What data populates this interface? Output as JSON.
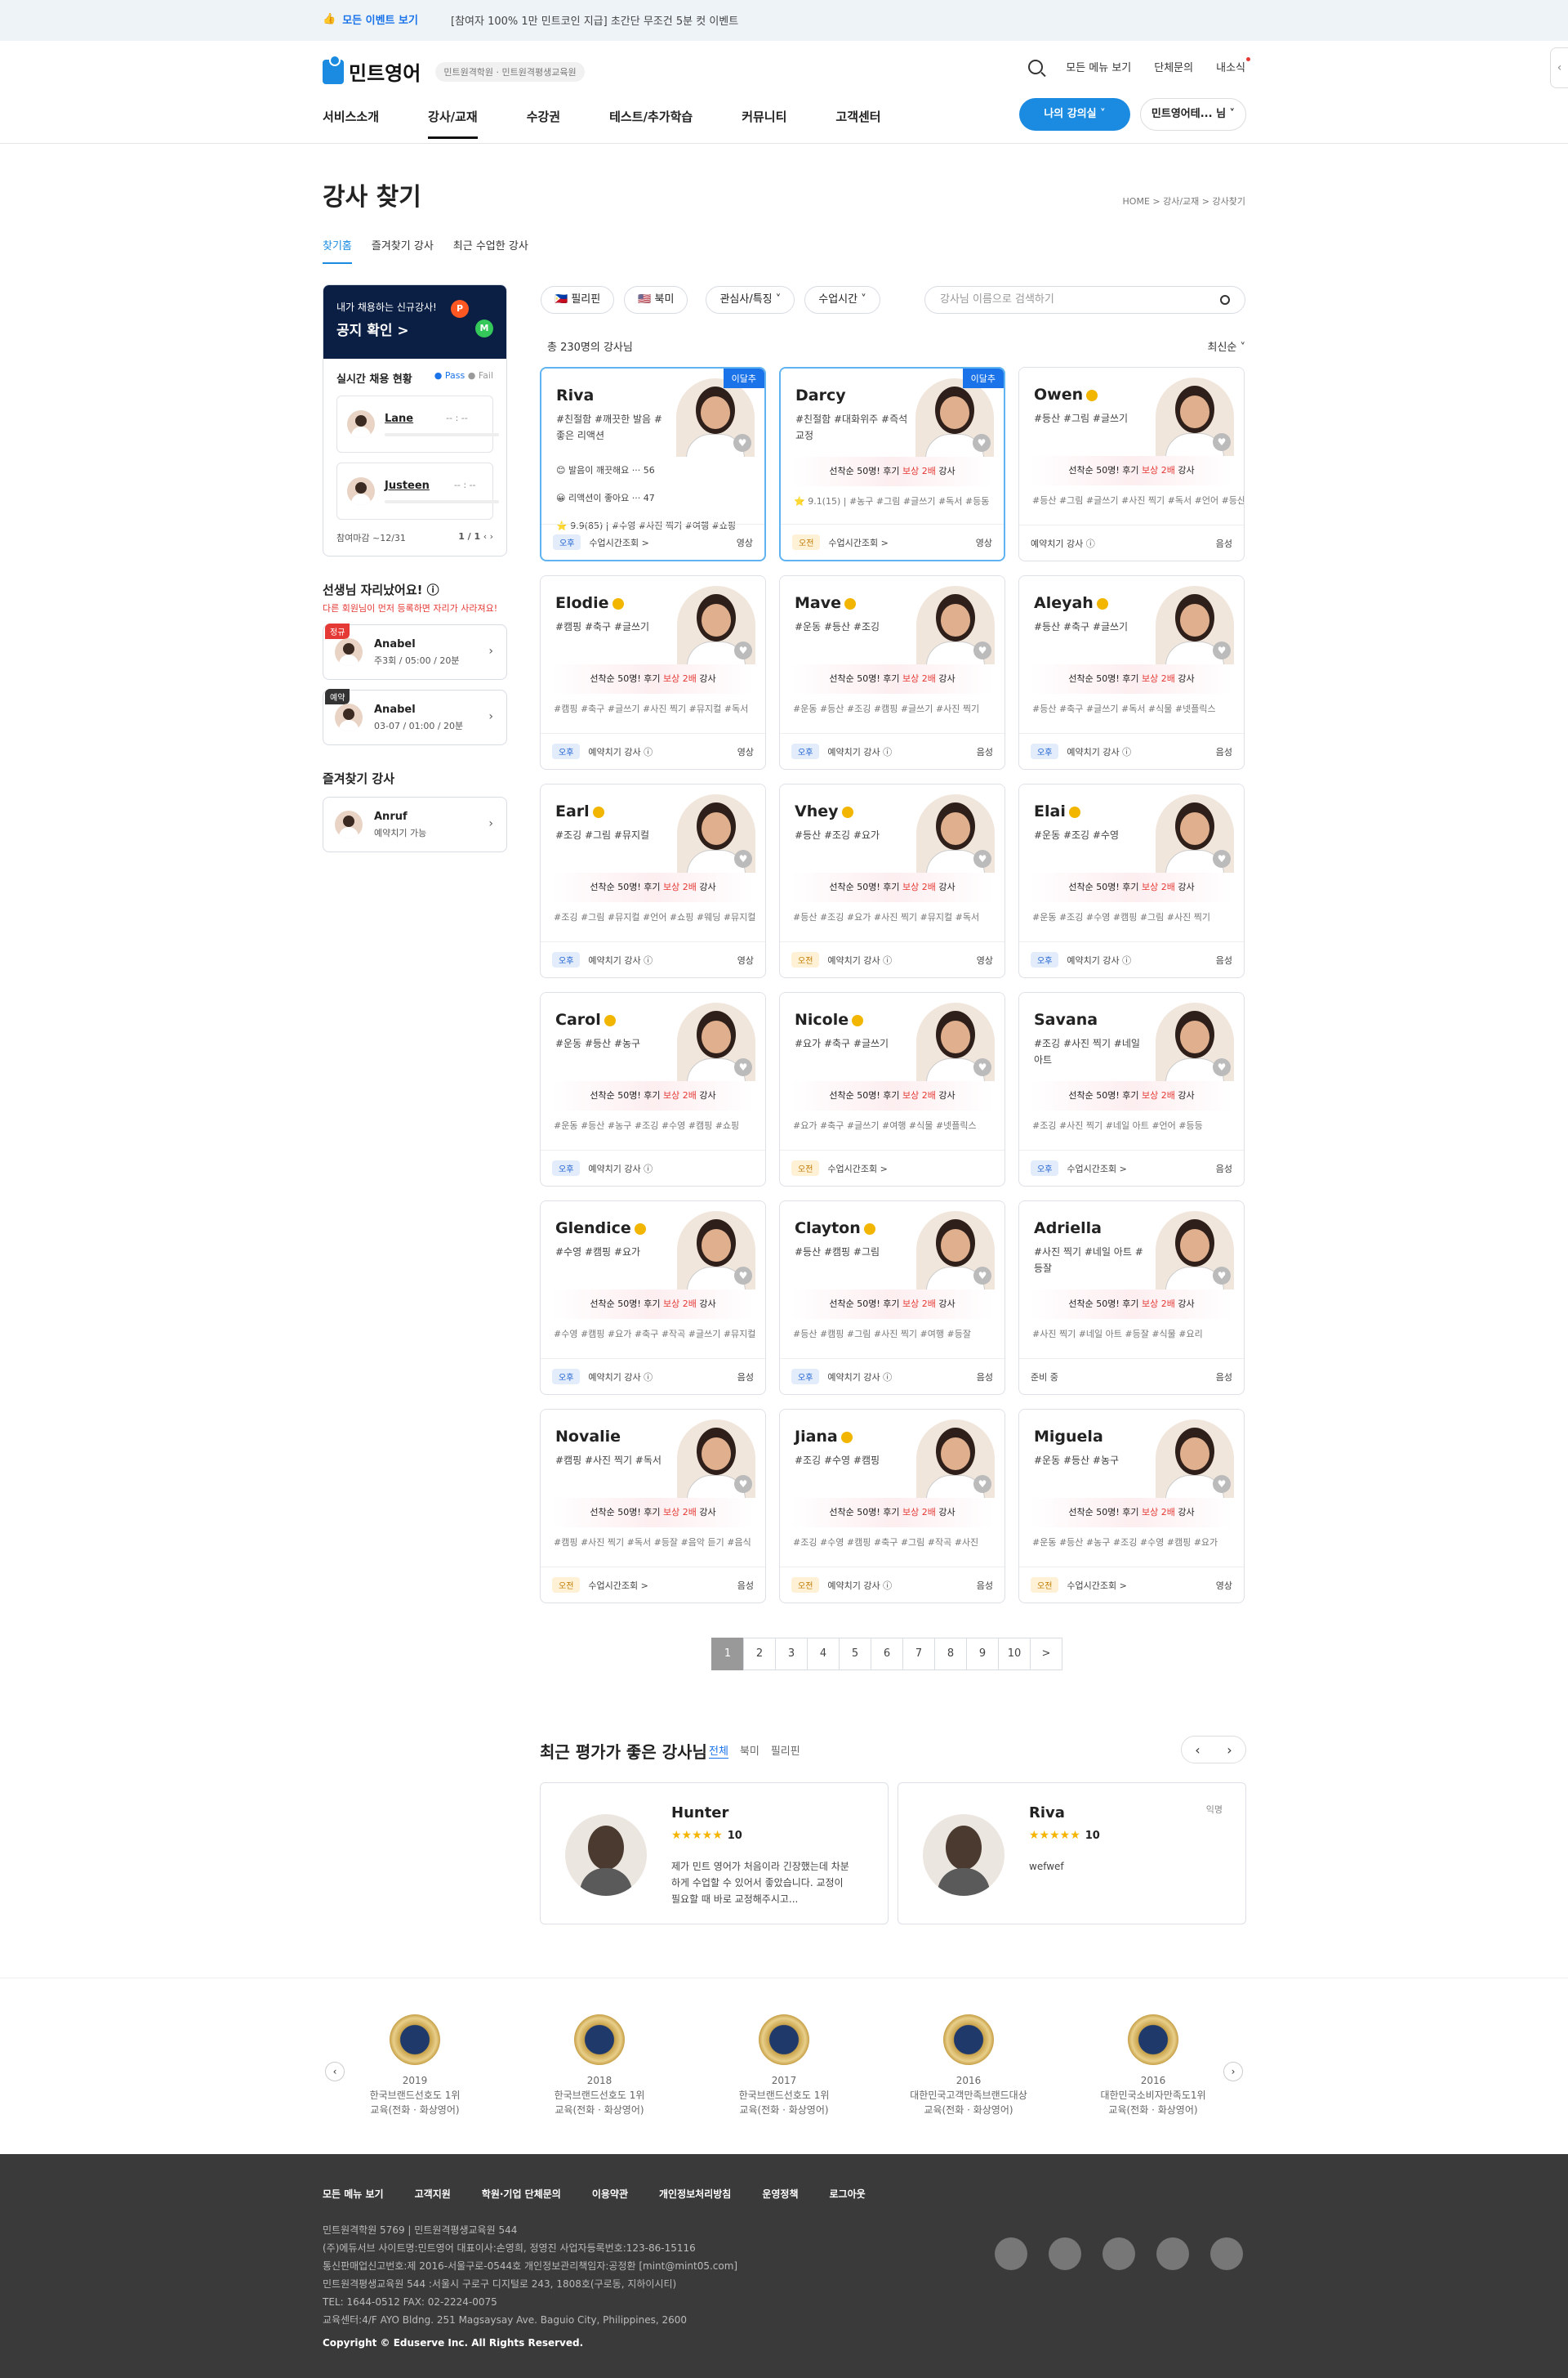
{
  "topbar": {
    "event_label": "모든 이벤트 보기",
    "notice": "[참여자 100% 1만 민트코인 지급] 초간단 무조건 5분 컷 이벤트"
  },
  "header": {
    "brand": "민트영어",
    "brand_sub": "민트원격학원 · 민트원격평생교육원",
    "links": [
      "모든 메뉴 보기",
      "단체문의",
      "내소식"
    ],
    "nav": [
      "서비스소개",
      "강사/교재",
      "수강권",
      "테스트/추가학습",
      "커뮤니티",
      "고객센터"
    ],
    "my_class": "나의 강의실 ˅",
    "user": "민트영어테... 님 ˅"
  },
  "page": {
    "title": "강사 찾기",
    "breadcrumb": "HOME > 강사/교재 > 강사찾기",
    "tabs": [
      "찾기홈",
      "즐겨찾기 강사",
      "최근 수업한 강사"
    ]
  },
  "sidebar": {
    "notice_small": "내가 채용하는 신규강사!",
    "notice_big": "공지 확인 >",
    "hiring_title": "실시간 채용 현황",
    "pass": "● Pass",
    "fail": "● Fail",
    "hires": [
      {
        "name": "Lane",
        "val": "-- : --"
      },
      {
        "name": "Justeen",
        "val": "-- : --"
      }
    ],
    "deadline": "참여마감 ~12/31",
    "page": "1 / 1",
    "slot_title": "선생님 자리났어요! ⓘ",
    "slot_sub": "다른 회원님이 먼저 등록하면 자리가 사라져요!",
    "slots": [
      {
        "tag": "정규",
        "name": "Anabel",
        "info": "주3회 / 05:00 / 20분"
      },
      {
        "tag": "예약",
        "name": "Anabel",
        "info": "03-07 / 01:00 / 20분"
      }
    ],
    "fav_title": "즐겨찾기 강사",
    "fav": {
      "name": "Anruf",
      "info": "예약치기 가능"
    }
  },
  "filters": {
    "chips": [
      "🇵🇭 필리핀",
      "🇺🇸 북미",
      "관심사/특징 ˅",
      "수업시간 ˅"
    ],
    "search_placeholder": "강사님 이름으로 검색하기",
    "count": "총 230명의 강사님",
    "sort": "최신순 ˅"
  },
  "promo": {
    "pre": "선착순 50명! 후기",
    "hl": "보상 2배",
    "post": "강사"
  },
  "tutors": [
    {
      "name": "Riva",
      "tags": "#친절함 #깨끗한 발음 #좋은 리액션",
      "new": "이달추",
      "slot": "오후",
      "action": "수업시간조회 >",
      "media": "영상",
      "review": [
        "😊 발음이 깨끗해요 ··· 56",
        "😀 리액션이 좋아요 ··· 47",
        "⭐ 9.9(85) | #수영 #사진 찍기 #여행 #쇼핑"
      ]
    },
    {
      "name": "Darcy",
      "tags": "#친절함 #대화위주 #즉석교정",
      "new": "이달추",
      "slot": "오전",
      "action": "수업시간조회 >",
      "media": "영상",
      "hashtags": "⭐ 9.1(15) | #농구 #그림 #글쓰기 #독서 #등동"
    },
    {
      "name": "Owen",
      "tags": "#등산 #그림 #글쓰기",
      "slot": "",
      "action": "예약치기 강사 ⓘ",
      "media": "음성",
      "hashtags": "#등산 #그림 #글쓰기 #사진 찍기 #독서 #언어 #등산"
    },
    {
      "name": "Elodie",
      "tags": "#캠핑 #축구 #글쓰기",
      "slot": "오후",
      "action": "예약치기 강사 ⓘ",
      "media": "영상",
      "hashtags": "#캠핑 #축구 #글쓰기 #사진 찍기 #뮤지컬 #독서"
    },
    {
      "name": "Mave",
      "tags": "#운동 #등산 #조깅",
      "slot": "오후",
      "action": "예약치기 강사 ⓘ",
      "media": "음성",
      "hashtags": "#운동 #등산 #조깅 #캠핑 #글쓰기 #사진 찍기"
    },
    {
      "name": "Aleyah",
      "tags": "#등산 #축구 #글쓰기",
      "slot": "오후",
      "action": "예약치기 강사 ⓘ",
      "media": "음성",
      "hashtags": "#등산 #축구 #글쓰기 #독서 #식물 #넷플릭스"
    },
    {
      "name": "Earl",
      "tags": "#조깅 #그림 #뮤지컬",
      "slot": "오후",
      "action": "예약치기 강사 ⓘ",
      "media": "영상",
      "hashtags": "#조깅 #그림 #뮤지컬 #언어 #쇼핑 #웨딩 #뮤지컬"
    },
    {
      "name": "Vhey",
      "tags": "#등산 #조깅 #요가",
      "slot": "오전",
      "action": "예약치기 강사 ⓘ",
      "media": "영상",
      "hashtags": "#등산 #조깅 #요가 #사진 찍기 #뮤지컬 #독서"
    },
    {
      "name": "Elai",
      "tags": "#운동 #조깅 #수영",
      "slot": "오후",
      "action": "예약치기 강사 ⓘ",
      "media": "음성",
      "hashtags": "#운동 #조깅 #수영 #캠핑 #그림 #사진 찍기"
    },
    {
      "name": "Carol",
      "tags": "#운동 #등산 #농구",
      "slot": "오후",
      "action": "예약치기 강사 ⓘ",
      "media": "",
      "hashtags": "#운동 #등산 #농구 #조깅 #수영 #캠핑 #쇼핑"
    },
    {
      "name": "Nicole",
      "tags": "#요가 #축구 #글쓰기",
      "slot": "오전",
      "action": "수업시간조회 >",
      "media": "",
      "hashtags": "#요가 #축구 #글쓰기 #여행 #식물 #넷플릭스"
    },
    {
      "name": "Savana",
      "tags": "#조깅 #사진 찍기 #네일 아트",
      "slot": "오후",
      "action": "수업시간조회 >",
      "media": "음성",
      "hashtags": "#조깅 #사진 찍기 #네일 아트 #언어 #등등"
    },
    {
      "name": "Glendice",
      "tags": "#수영 #캠핑 #요가",
      "slot": "오후",
      "action": "예약치기 강사 ⓘ",
      "media": "음성",
      "hashtags": "#수영 #캠핑 #요가 #축구 #작곡 #글쓰기 #뮤지컬"
    },
    {
      "name": "Clayton",
      "tags": "#등산 #캠핑 #그림",
      "slot": "오후",
      "action": "예약치기 강사 ⓘ",
      "media": "음성",
      "hashtags": "#등산 #캠핑 #그림 #사진 찍기 #여행 #등잘"
    },
    {
      "name": "Adriella",
      "tags": "#사진 찍기 #네일 아트 #등잘",
      "slot": "",
      "action": "준비 중",
      "media": "음성",
      "hashtags": "#사진 찍기 #네일 아트 #등잘 #식물 #요리"
    },
    {
      "name": "Novalie",
      "tags": "#캠핑 #사진 찍기 #독서",
      "slot": "오전",
      "action": "수업시간조회 >",
      "media": "음성",
      "hashtags": "#캠핑 #사진 찍기 #독서 #등잘 #음악 듣기 #음식"
    },
    {
      "name": "Jiana",
      "tags": "#조깅 #수영 #캠핑",
      "slot": "오전",
      "action": "예약치기 강사 ⓘ",
      "media": "음성",
      "hashtags": "#조깅 #수영 #캠핑 #축구 #그림 #작곡 #사진"
    },
    {
      "name": "Miguela",
      "tags": "#운동 #등산 #농구",
      "slot": "오전",
      "action": "수업시간조회 >",
      "media": "영상",
      "hashtags": "#운동 #등산 #농구 #조깅 #수영 #캠핑 #요가"
    }
  ],
  "pager": [
    "1",
    "2",
    "3",
    "4",
    "5",
    "6",
    "7",
    "8",
    "9",
    "10",
    ">"
  ],
  "recent": {
    "title": "최근 평가가 좋은 강사님",
    "tabs": [
      "전체",
      "북미",
      "필리핀"
    ],
    "reviews": [
      {
        "name": "Hunter",
        "stars": "★★★★★",
        "score": "10",
        "text": "제가 민트 영어가 처음이라 긴장했는데 차분하게 수업할 수 있어서 좋았습니다. 교정이 필요할 때 바로 교정해주시고...",
        "anon": ""
      },
      {
        "name": "Riva",
        "stars": "★★★★★",
        "score": "10",
        "text": "wefwef",
        "anon": "익명"
      }
    ]
  },
  "awards": [
    {
      "year": "2019",
      "l1": "한국브랜드선호도 1위",
      "l2": "교육(전화 · 화상영어)"
    },
    {
      "year": "2018",
      "l1": "한국브랜드선호도 1위",
      "l2": "교육(전화 · 화상영어)"
    },
    {
      "year": "2017",
      "l1": "한국브랜드선호도 1위",
      "l2": "교육(전화 · 화상영어)"
    },
    {
      "year": "2016",
      "l1": "대한민국고객만족브랜드대상",
      "l2": "교육(전화 · 화상영어)"
    },
    {
      "year": "2016",
      "l1": "대한민국소비자만족도1위",
      "l2": "교육(전화 · 화상영어)"
    }
  ],
  "footer": {
    "links": [
      "모든 메뉴 보기",
      "고객지원",
      "학원·기업 단체문의",
      "이용약관",
      "개인정보처리방침",
      "운영정책",
      "로그아웃"
    ],
    "info": [
      "민트원격학원 5769 | 민트원격평생교육원 544",
      "(주)에듀서브  사이트명:민트영어 대표이사:손영희, 정영진  사업자등록번호:123-86-15116",
      "통신판매업신고번호:제 2016-서울구로-0544호  개인정보관리책임자:공정환 [mint@mint05.com]",
      "민트원격평생교육원 544 :서울시 구로구 디지털로 243, 1808호(구로동, 지하이시티)",
      "TEL: 1644-0512 FAX: 02-2224-0075",
      "교육센터:4/F AYO Bldng. 251 Magsaysay Ave. Baguio City, Philippines, 2600"
    ],
    "copyright": "Copyright © Eduserve Inc. All Rights Reserved."
  }
}
